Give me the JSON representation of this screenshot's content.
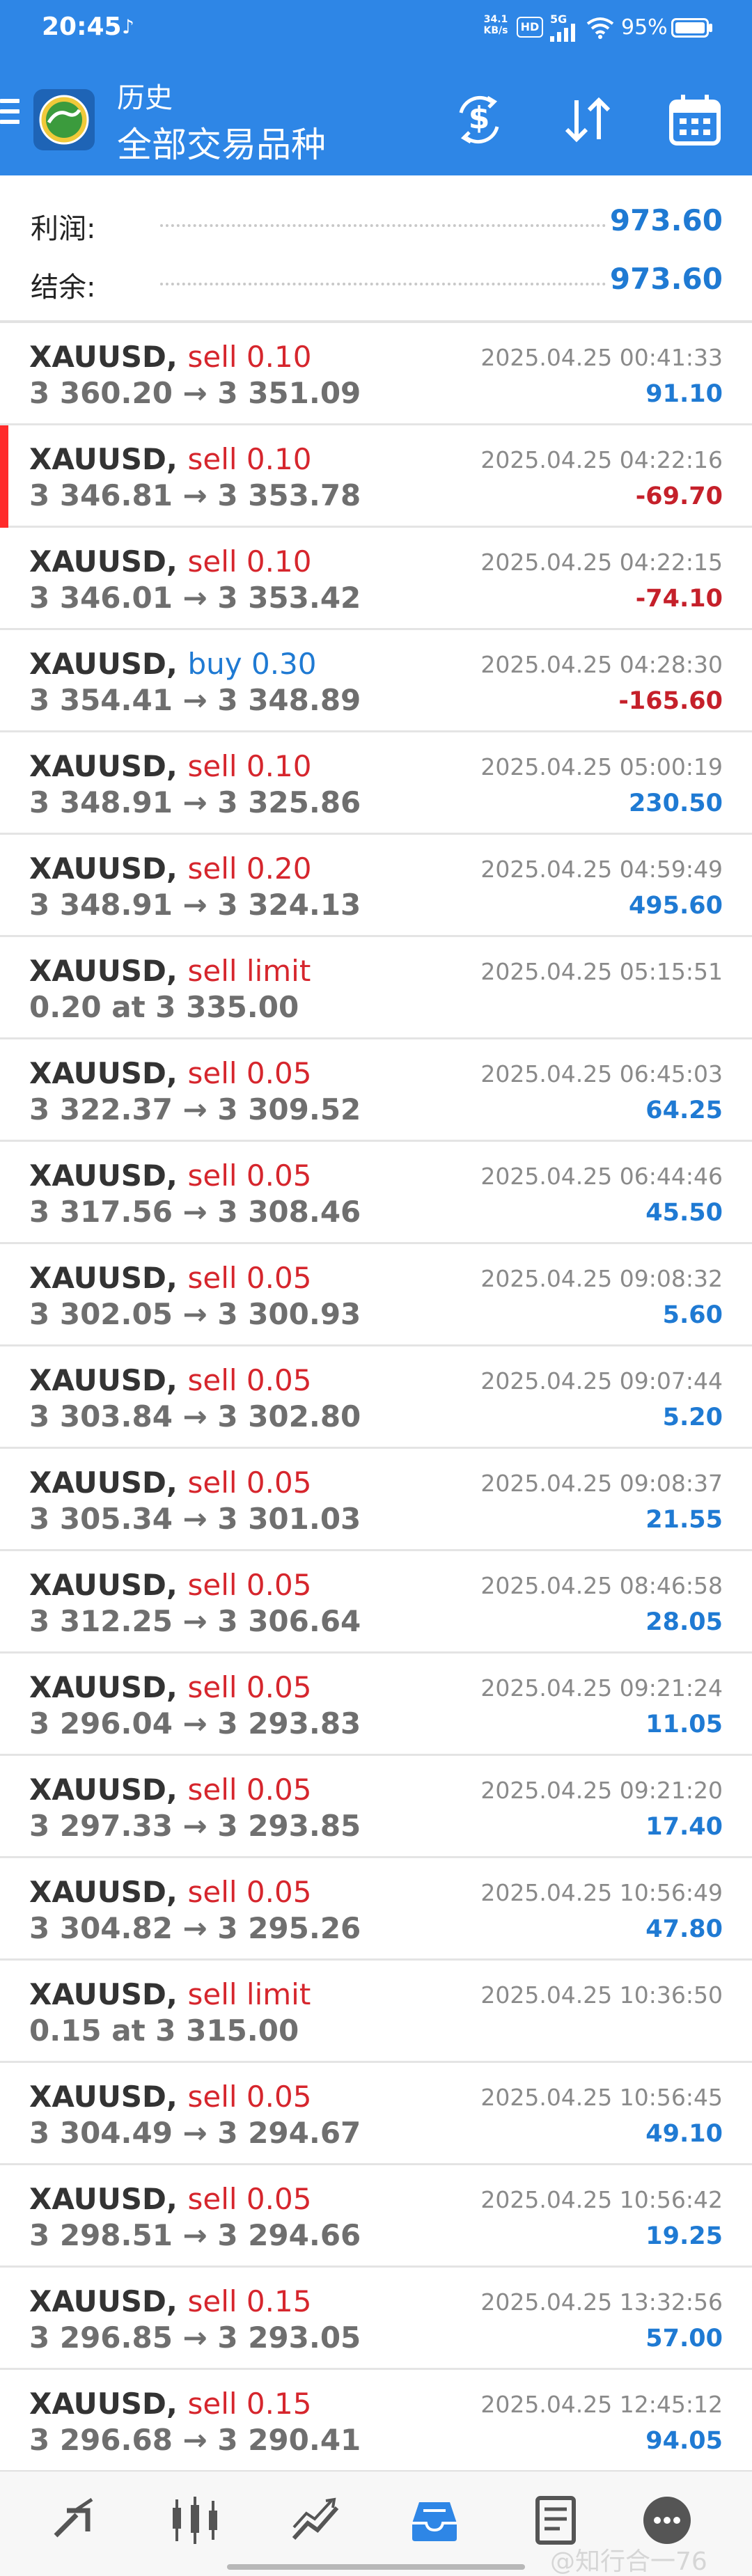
{
  "status_bar": {
    "time": "20:45",
    "net_speed_value": "34.1",
    "net_speed_unit": "KB/s",
    "hd": "HD",
    "network": "5G",
    "battery": "95%"
  },
  "header": {
    "title": "历史",
    "subtitle": "全部交易品种"
  },
  "summary": {
    "profit_label": "利润:",
    "profit_value": "973.60",
    "balance_label": "结余:",
    "balance_value": "973.60"
  },
  "trades": [
    {
      "symbol": "XAUUSD,",
      "side": "sell",
      "side_text": "sell 0.10",
      "prices": "3 360.20 → 3 351.09",
      "time": "2025.04.25 00:41:33",
      "profit": "91.10",
      "sign": "pos",
      "marked": false
    },
    {
      "symbol": "XAUUSD,",
      "side": "sell",
      "side_text": "sell 0.10",
      "prices": "3 346.81 → 3 353.78",
      "time": "2025.04.25 04:22:16",
      "profit": "-69.70",
      "sign": "neg",
      "marked": true
    },
    {
      "symbol": "XAUUSD,",
      "side": "sell",
      "side_text": "sell 0.10",
      "prices": "3 346.01 → 3 353.42",
      "time": "2025.04.25 04:22:15",
      "profit": "-74.10",
      "sign": "neg",
      "marked": false
    },
    {
      "symbol": "XAUUSD,",
      "side": "buy",
      "side_text": "buy 0.30",
      "prices": "3 354.41 → 3 348.89",
      "time": "2025.04.25 04:28:30",
      "profit": "-165.60",
      "sign": "neg",
      "marked": false
    },
    {
      "symbol": "XAUUSD,",
      "side": "sell",
      "side_text": "sell 0.10",
      "prices": "3 348.91 → 3 325.86",
      "time": "2025.04.25 05:00:19",
      "profit": "230.50",
      "sign": "pos",
      "marked": false
    },
    {
      "symbol": "XAUUSD,",
      "side": "sell",
      "side_text": "sell 0.20",
      "prices": "3 348.91 → 3 324.13",
      "time": "2025.04.25 04:59:49",
      "profit": "495.60",
      "sign": "pos",
      "marked": false
    },
    {
      "symbol": "XAUUSD,",
      "side": "sell",
      "side_text": "sell limit",
      "prices": "0.20 at 3 335.00",
      "time": "2025.04.25 05:15:51",
      "profit": "",
      "sign": "pos",
      "marked": false
    },
    {
      "symbol": "XAUUSD,",
      "side": "sell",
      "side_text": "sell 0.05",
      "prices": "3 322.37 → 3 309.52",
      "time": "2025.04.25 06:45:03",
      "profit": "64.25",
      "sign": "pos",
      "marked": false
    },
    {
      "symbol": "XAUUSD,",
      "side": "sell",
      "side_text": "sell 0.05",
      "prices": "3 317.56 → 3 308.46",
      "time": "2025.04.25 06:44:46",
      "profit": "45.50",
      "sign": "pos",
      "marked": false
    },
    {
      "symbol": "XAUUSD,",
      "side": "sell",
      "side_text": "sell 0.05",
      "prices": "3 302.05 → 3 300.93",
      "time": "2025.04.25 09:08:32",
      "profit": "5.60",
      "sign": "pos",
      "marked": false
    },
    {
      "symbol": "XAUUSD,",
      "side": "sell",
      "side_text": "sell 0.05",
      "prices": "3 303.84 → 3 302.80",
      "time": "2025.04.25 09:07:44",
      "profit": "5.20",
      "sign": "pos",
      "marked": false
    },
    {
      "symbol": "XAUUSD,",
      "side": "sell",
      "side_text": "sell 0.05",
      "prices": "3 305.34 → 3 301.03",
      "time": "2025.04.25 09:08:37",
      "profit": "21.55",
      "sign": "pos",
      "marked": false
    },
    {
      "symbol": "XAUUSD,",
      "side": "sell",
      "side_text": "sell 0.05",
      "prices": "3 312.25 → 3 306.64",
      "time": "2025.04.25 08:46:58",
      "profit": "28.05",
      "sign": "pos",
      "marked": false
    },
    {
      "symbol": "XAUUSD,",
      "side": "sell",
      "side_text": "sell 0.05",
      "prices": "3 296.04 → 3 293.83",
      "time": "2025.04.25 09:21:24",
      "profit": "11.05",
      "sign": "pos",
      "marked": false
    },
    {
      "symbol": "XAUUSD,",
      "side": "sell",
      "side_text": "sell 0.05",
      "prices": "3 297.33 → 3 293.85",
      "time": "2025.04.25 09:21:20",
      "profit": "17.40",
      "sign": "pos",
      "marked": false
    },
    {
      "symbol": "XAUUSD,",
      "side": "sell",
      "side_text": "sell 0.05",
      "prices": "3 304.82 → 3 295.26",
      "time": "2025.04.25 10:56:49",
      "profit": "47.80",
      "sign": "pos",
      "marked": false
    },
    {
      "symbol": "XAUUSD,",
      "side": "sell",
      "side_text": "sell limit",
      "prices": "0.15 at 3 315.00",
      "time": "2025.04.25 10:36:50",
      "profit": "",
      "sign": "pos",
      "marked": false
    },
    {
      "symbol": "XAUUSD,",
      "side": "sell",
      "side_text": "sell 0.05",
      "prices": "3 304.49 → 3 294.67",
      "time": "2025.04.25 10:56:45",
      "profit": "49.10",
      "sign": "pos",
      "marked": false
    },
    {
      "symbol": "XAUUSD,",
      "side": "sell",
      "side_text": "sell 0.05",
      "prices": "3 298.51 → 3 294.66",
      "time": "2025.04.25 10:56:42",
      "profit": "19.25",
      "sign": "pos",
      "marked": false
    },
    {
      "symbol": "XAUUSD,",
      "side": "sell",
      "side_text": "sell 0.15",
      "prices": "3 296.85 → 3 293.05",
      "time": "2025.04.25 13:32:56",
      "profit": "57.00",
      "sign": "pos",
      "marked": false
    },
    {
      "symbol": "XAUUSD,",
      "side": "sell",
      "side_text": "sell 0.15",
      "prices": "3 296.68 → 3 290.41",
      "time": "2025.04.25 12:45:12",
      "profit": "94.05",
      "sign": "pos",
      "marked": false
    }
  ],
  "watermark": "@知行合一76",
  "icons": [
    "menu-icon",
    "app-logo-icon",
    "currency-exchange-icon",
    "sort-arrows-icon",
    "calendar-icon",
    "quotes-icon",
    "chart-icon",
    "trade-icon",
    "history-icon",
    "journal-icon",
    "messages-icon"
  ],
  "colors": {
    "accent": "#2e86e6",
    "sell": "#d6262d",
    "buy": "#1f7ad3",
    "profit_positive": "#1f7ad3",
    "profit_negative": "#c5202a"
  }
}
